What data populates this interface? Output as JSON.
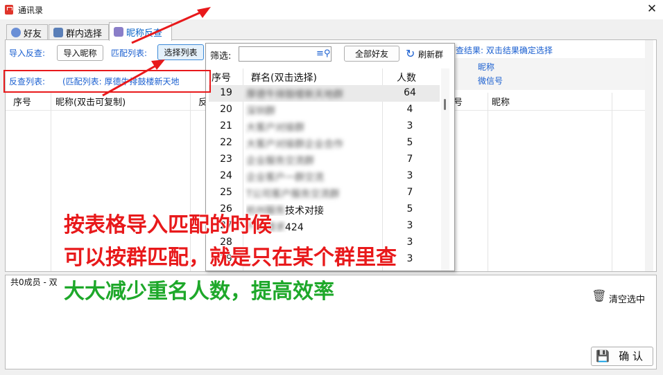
{
  "window": {
    "title": "通讯录",
    "close": "✕"
  },
  "tabs": [
    {
      "label": "好友"
    },
    {
      "label": "群内选择"
    },
    {
      "label": "昵称反查"
    }
  ],
  "toolbar": {
    "import_label": "导入反查:",
    "import_button": "导入昵称",
    "match_label": "匹配列表:",
    "select_list_button": "选择列表"
  },
  "reverse_list": {
    "label": "反查列表:",
    "value": "(匹配列表: 厚德牛排鼓楼新天地"
  },
  "left_table": {
    "headers": [
      "序号",
      "昵称(双击可复制)",
      "反"
    ]
  },
  "result": {
    "label": "查结果: 双击结果确定选择",
    "options": [
      "昵称",
      "微信号"
    ],
    "headers": [
      "号",
      "昵称"
    ]
  },
  "popup": {
    "filter_label": "筛选:",
    "search_value": "",
    "all_friends_button": "全部好友",
    "refresh_label": "刷新群",
    "headers": [
      "序号",
      "群名(双击选择)",
      "人数"
    ],
    "rows": [
      {
        "no": "19",
        "name": "厚德牛排鼓楼新天地群",
        "count": "64",
        "blurred": true,
        "selected": true
      },
      {
        "no": "20",
        "name": "深圳群",
        "count": "4",
        "blurred": true
      },
      {
        "no": "21",
        "name": "大客户对接群",
        "count": "3",
        "blurred": true
      },
      {
        "no": "22",
        "name": "大客户对接群企业合作",
        "count": "5",
        "blurred": true
      },
      {
        "no": "23",
        "name": "企业服务交流群",
        "count": "7",
        "blurred": true
      },
      {
        "no": "24",
        "name": "企业客户一群交流",
        "count": "3",
        "blurred": true
      },
      {
        "no": "25",
        "name": "T公司客户服务交流群",
        "count": "7",
        "blurred": true
      },
      {
        "no": "26",
        "name": "技术对接",
        "count": "5",
        "prefix": "杭州服务",
        "blurred": false
      },
      {
        "no": "27",
        "name": "424",
        "count": "3",
        "prefix": "产品需求",
        "blurred": false
      },
      {
        "no": "28",
        "name": "",
        "count": "3",
        "blurred": true
      },
      {
        "no": "29",
        "name": "",
        "count": "3",
        "blurred": true
      }
    ]
  },
  "footer": {
    "member_count": "共0成员 - 双",
    "clear_selected": "清空选中",
    "confirm": "确 认"
  },
  "annotation": {
    "line1": "按表格导入匹配的时候",
    "line2": "可以按群匹配，就是只在某个群里查",
    "line3": "大大减少重名人数，提高效率"
  },
  "colors": {
    "accent": "#1a5fd0",
    "annotation_red": "#e8191b",
    "annotation_green": "#1ea82a"
  }
}
